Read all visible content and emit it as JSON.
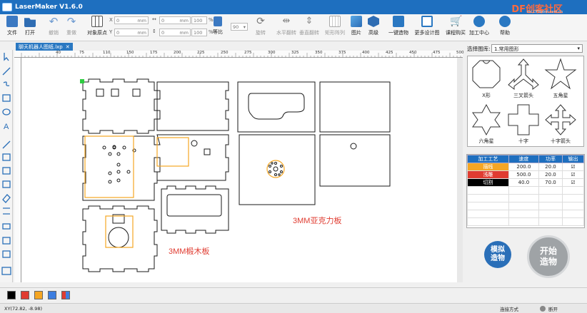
{
  "app": {
    "title": "LaserMaker V1.6.0",
    "brand": "DF创客社区",
    "brand_sub": "mc.DFRobot.com.cn"
  },
  "toolbar": {
    "file": "文件",
    "open": "打开",
    "undo": "撤销",
    "redo": "重做",
    "object_origin": "对象原点",
    "x_value": "0",
    "y_value": "0",
    "w_value": "0",
    "h_value": "0",
    "mm": "mm",
    "pct_w": "100",
    "pct_h": "100",
    "pct": "%",
    "lock_ratio": "等比",
    "angle_value": "90",
    "rotate": "旋转",
    "flip_h": "水平翻转",
    "flip_v": "垂直翻转",
    "matrix": "矩形阵列",
    "image": "图片",
    "advanced": "高级",
    "one_click": "一键造物",
    "more_design": "更多设计图",
    "course": "课程购买",
    "processing_center": "加工中心",
    "help": "帮助"
  },
  "document_tab": {
    "label": "聊天机器人图纸.lxp"
  },
  "ruler_labels": [
    "40",
    "75",
    "110",
    "150",
    "175",
    "200",
    "225",
    "250",
    "275",
    "300",
    "325",
    "350",
    "375",
    "400",
    "425",
    "450",
    "475",
    "500"
  ],
  "canvas": {
    "label_wood": "3MM椴木板",
    "label_acrylic": "3MM亚克力板"
  },
  "library": {
    "label": "选择图库:",
    "selected": "1.常用图形",
    "shapes": [
      {
        "name": "X形"
      },
      {
        "name": "三叉箭头"
      },
      {
        "name": "五角星"
      },
      {
        "name": "六角星"
      },
      {
        "name": "十字"
      },
      {
        "name": "十字箭头"
      }
    ]
  },
  "process_table": {
    "headers": [
      "加工工艺",
      "速度",
      "功率",
      "输出"
    ],
    "rows": [
      {
        "name": "描线",
        "speed": "200.0",
        "power": "20.0",
        "color": "#f5a623",
        "text_color": "#ffffff"
      },
      {
        "name": "浅雕",
        "speed": "500.0",
        "power": "20.0",
        "color": "#e03c31",
        "text_color": "#ffffff"
      },
      {
        "name": "切割",
        "speed": "40.0",
        "power": "70.0",
        "color": "#000000",
        "text_color": "#ffffff"
      }
    ]
  },
  "actions": {
    "simulate": "模拟\n造物",
    "start": "开始\n造物"
  },
  "palette": {
    "colors": [
      "#000000",
      "#e03c31",
      "#f5a623",
      "#3d7ee0",
      "multi"
    ]
  },
  "status": {
    "coords": "XY(72.82, -8.98)",
    "connect_label": "连接方式",
    "connection": "断开"
  },
  "colors": {
    "accent": "#1e6fbf",
    "brand": "#ff6a3d",
    "draw_line": "#1a1a1a",
    "engrave": "#f5a623"
  }
}
